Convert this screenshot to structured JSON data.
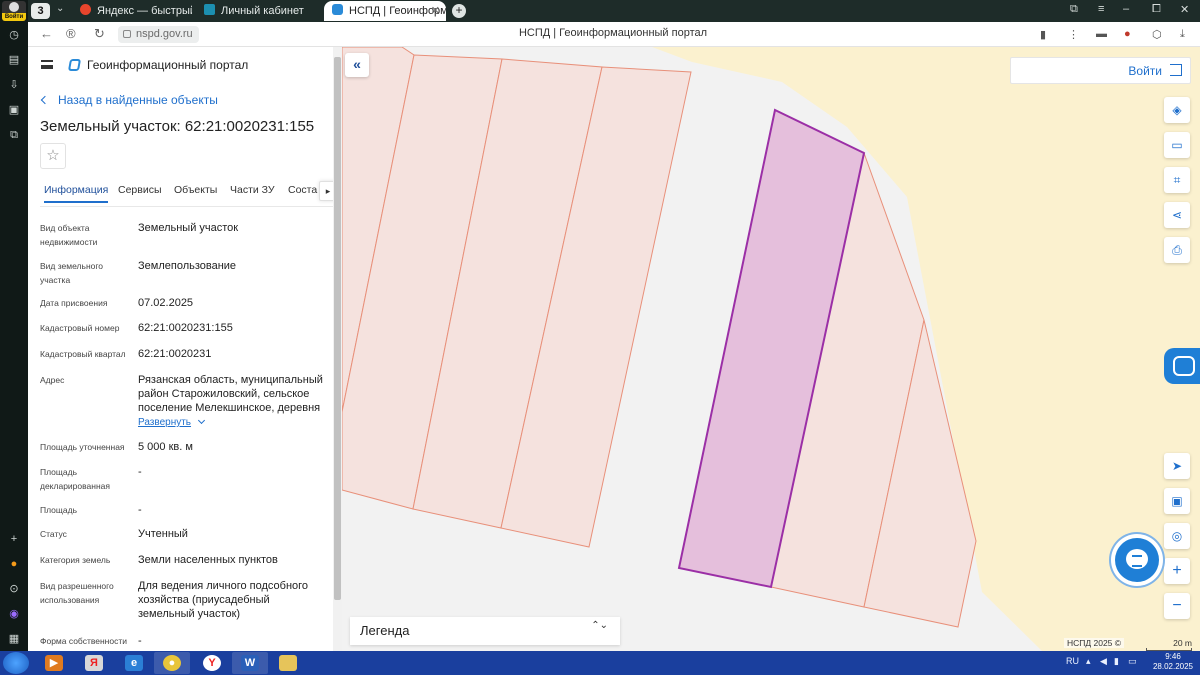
{
  "browser": {
    "login_badge": "Войти",
    "tab_count": "3",
    "tabs": [
      {
        "label": "Яндекс — быстрый поиск",
        "icon_color": "#e8452c",
        "active": false
      },
      {
        "label": "Личный кабинет",
        "icon_color": "#1c8fb0",
        "active": false
      },
      {
        "label": "НСПД | Геоинформаци",
        "icon_color": "#2a8bd8",
        "active": true
      }
    ],
    "url": "nspd.gov.ru",
    "page_title": "НСПД | Геоинформационный портал"
  },
  "panel": {
    "portal_title": "Геоинформационный портал",
    "back_label": "Назад в найденные объекты",
    "object_title": "Земельный участок: 62:21:0020231:155",
    "favorite_glyph": "☆",
    "tabs": [
      "Информация",
      "Сервисы",
      "Объекты",
      "Части ЗУ",
      "Соста"
    ],
    "active_tab": "Информация",
    "next_glyph": "▸",
    "expand_label": "Развернуть",
    "fields": [
      {
        "key": "Вид объекта недвижимости",
        "value": "Земельный участок"
      },
      {
        "key": "Вид земельного участка",
        "value": "Землепользование"
      },
      {
        "key": "Дата присвоения",
        "value": "07.02.2025"
      },
      {
        "key": "Кадастровый номер",
        "value": "62:21:0020231:155"
      },
      {
        "key": "Кадастровый квартал",
        "value": "62:21:0020231"
      },
      {
        "key": "Адрес",
        "value": "Рязанская область, муниципальный район Старожиловский, сельское поселение Мелекшинское, деревня"
      },
      {
        "key": "Площадь уточненная",
        "value": "5 000 кв. м"
      },
      {
        "key": "Площадь декларированная",
        "value": "-"
      },
      {
        "key": "Площадь",
        "value": "-"
      },
      {
        "key": "Статус",
        "value": "Учтенный"
      },
      {
        "key": "Категория земель",
        "value": "Земли населенных пунктов"
      },
      {
        "key": "Вид разрешенного использования",
        "value": "Для ведения личного подсобного хозяйства (приусадебный земельный участок)"
      },
      {
        "key": "Форма собственности",
        "value": "-"
      }
    ]
  },
  "map": {
    "collapse_glyph": "«",
    "login_label": "Войти",
    "legend_label": "Легенда",
    "legend_glyph": "⌃⌄",
    "copyright": "НСПД 2025 ©",
    "scale_label": "20 m",
    "colors": {
      "parcel_fill": "#f5e2de",
      "parcel_stroke": "#e8907a",
      "selected_fill": "#e5bfdc",
      "selected_stroke": "#9b2fa6",
      "field_fill": "#fbf1cf",
      "accent": "#1f6fcc"
    },
    "tools": [
      {
        "name": "layers-icon",
        "glyph": "◈"
      },
      {
        "name": "ruler-icon",
        "glyph": "▭"
      },
      {
        "name": "select-area-icon",
        "glyph": "⌗"
      },
      {
        "name": "share-icon",
        "glyph": "⋖"
      },
      {
        "name": "print-icon",
        "glyph": "⎙"
      },
      {
        "name": "locate-icon",
        "glyph": "➤"
      },
      {
        "name": "minimap-icon",
        "glyph": "▣"
      },
      {
        "name": "geolocation-icon",
        "glyph": "◎"
      },
      {
        "name": "zoom-in-icon",
        "glyph": "+"
      },
      {
        "name": "zoom-out-icon",
        "glyph": "−"
      }
    ]
  },
  "taskbar": {
    "lang": "RU",
    "time": "9:46",
    "date": "28.02.2025"
  }
}
